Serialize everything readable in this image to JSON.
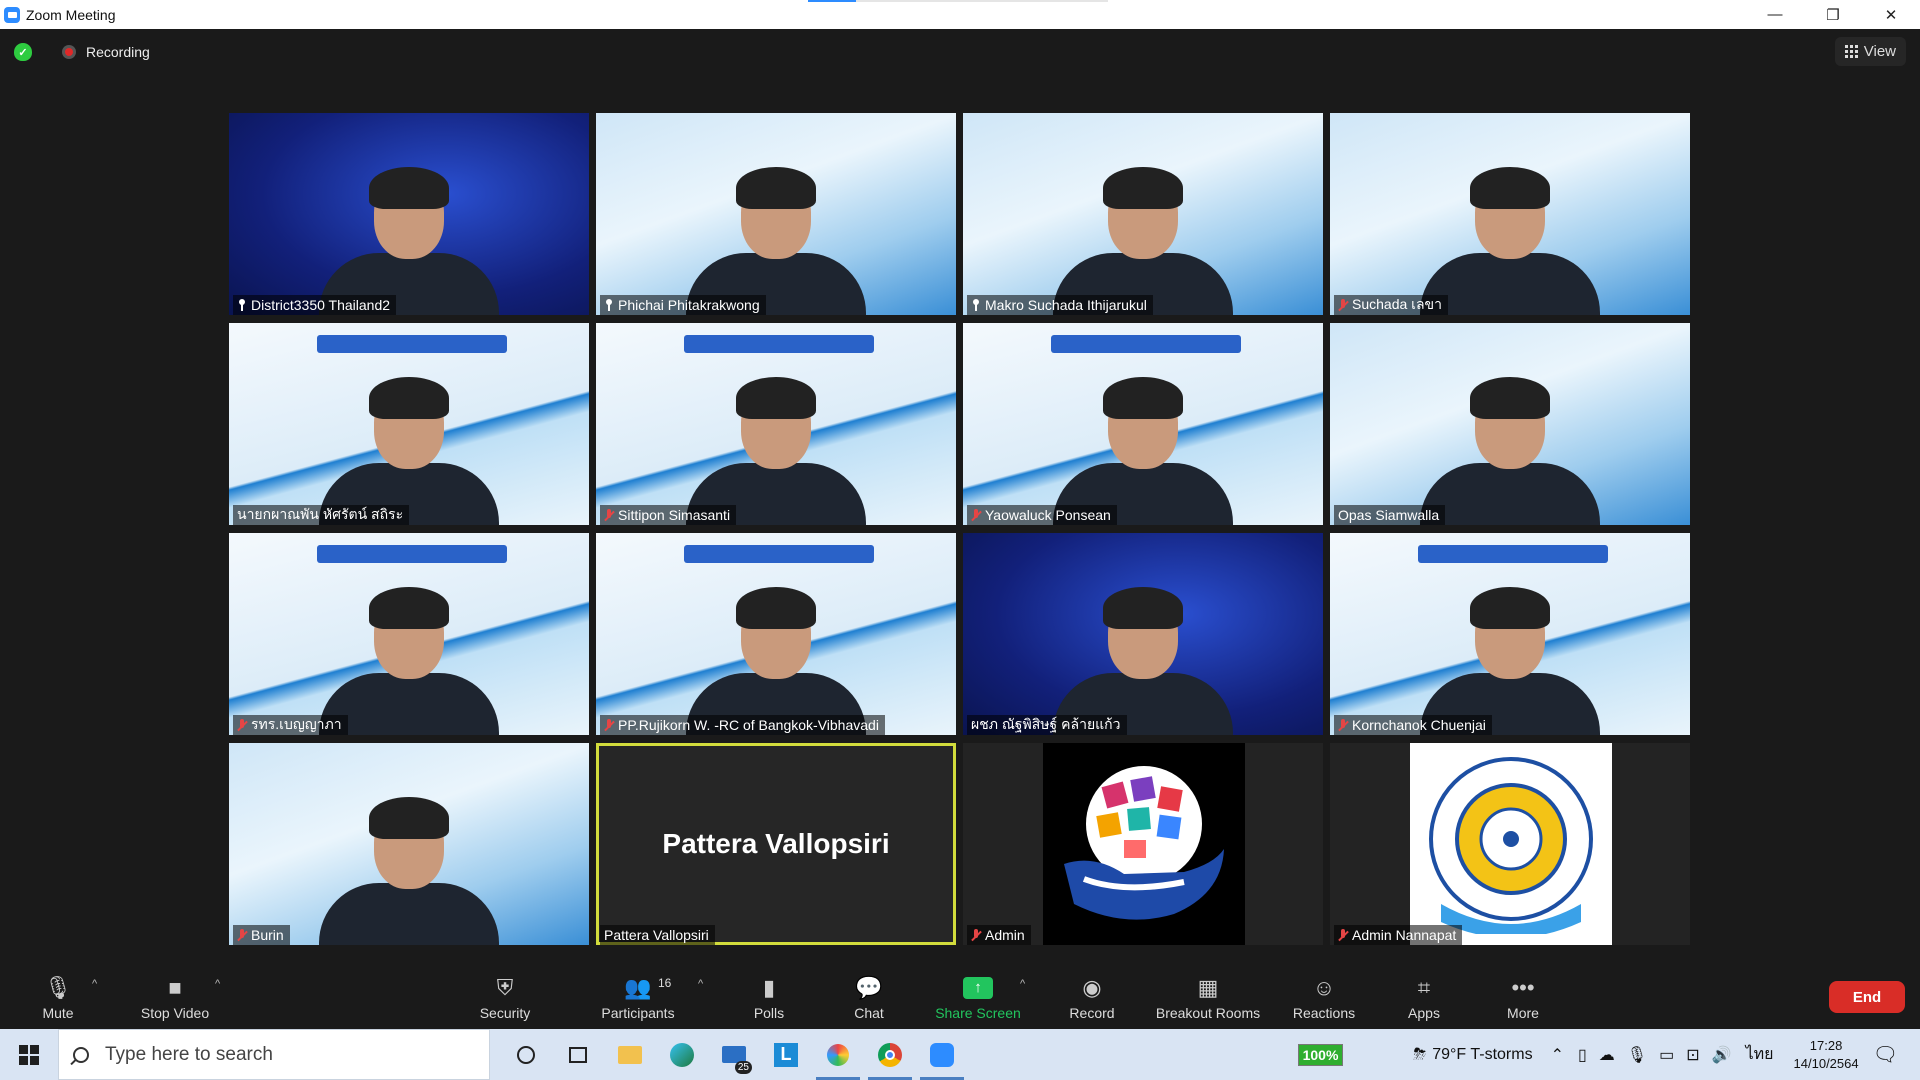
{
  "window": {
    "title": "Zoom Meeting",
    "minimize": "—",
    "restore": "❐",
    "close": "✕"
  },
  "top": {
    "recording_label": "Recording",
    "view_label": "View"
  },
  "tiles": [
    {
      "name": "District3350 Thailand2",
      "muted": false,
      "pinned": true,
      "bg": "blue"
    },
    {
      "name": "Phichai Phitakrakwong",
      "muted": false,
      "pinned": true,
      "bg": "light"
    },
    {
      "name": "Makro Suchada Ithijarukul",
      "muted": false,
      "pinned": true,
      "bg": "light"
    },
    {
      "name": "Suchada เลขา",
      "muted": true,
      "pinned": false,
      "bg": "light"
    },
    {
      "name": "นายกผาณพัน หัศรัตน์ สถิระ",
      "muted": false,
      "pinned": false,
      "bg": "white-curve"
    },
    {
      "name": "Sittipon Simasanti",
      "muted": true,
      "pinned": false,
      "bg": "white-curve"
    },
    {
      "name": "Yaowaluck Ponsean",
      "muted": true,
      "pinned": false,
      "bg": "white-curve"
    },
    {
      "name": "Opas Siamwalla",
      "muted": false,
      "pinned": false,
      "bg": "light"
    },
    {
      "name": "รทร.เบญญาภา",
      "muted": true,
      "pinned": false,
      "bg": "white-curve"
    },
    {
      "name": "PP.Rujikorn W. -RC of Bangkok-Vibhavadi",
      "muted": true,
      "pinned": false,
      "bg": "white-curve"
    },
    {
      "name": "ผชภ ณัฐพิสิษฐ์ คล้ายแก้ว",
      "muted": false,
      "pinned": false,
      "bg": "blue"
    },
    {
      "name": "Kornchanok Chuenjai",
      "muted": true,
      "pinned": false,
      "bg": "white-curve"
    },
    {
      "name": "Burin",
      "muted": true,
      "pinned": false,
      "bg": "light"
    },
    {
      "name": "Pattera Vallopsiri",
      "muted": false,
      "pinned": false,
      "bg": "namecard",
      "card_text": "Pattera Vallopsiri"
    },
    {
      "name": "Admin",
      "muted": true,
      "pinned": false,
      "bg": "logo-hand"
    },
    {
      "name": "Admin Nannapat",
      "muted": true,
      "pinned": false,
      "bg": "logo-rotary"
    }
  ],
  "toolbar": {
    "mute": "Mute",
    "stop_video": "Stop Video",
    "security": "Security",
    "participants": "Participants",
    "participants_count": "16",
    "polls": "Polls",
    "chat": "Chat",
    "share_screen": "Share Screen",
    "record": "Record",
    "breakout_rooms": "Breakout Rooms",
    "reactions": "Reactions",
    "apps": "Apps",
    "more": "More",
    "end": "End"
  },
  "taskbar": {
    "search_placeholder": "Type here to search",
    "mail_badge": "25",
    "battery": "100%",
    "weather": "79°F  T-storms",
    "language": "ไทย",
    "time": "17:28",
    "date": "14/10/2564"
  },
  "colors": {
    "accent": "#2d8cff",
    "active_speaker": "#d2dc3c",
    "end": "#d92d27",
    "share": "#22c55e"
  }
}
